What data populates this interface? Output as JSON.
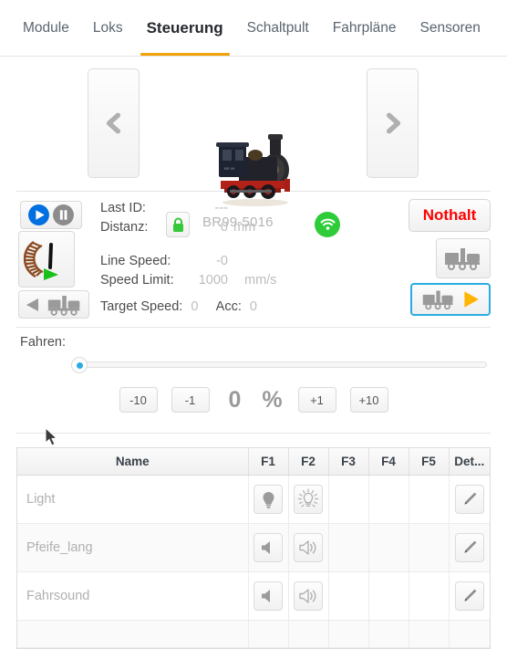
{
  "nav": {
    "tabs": [
      {
        "label": "Module",
        "active": false
      },
      {
        "label": "Loks",
        "active": false
      },
      {
        "label": "Steuerung",
        "active": true
      },
      {
        "label": "Schaltpult",
        "active": false
      },
      {
        "label": "Fahrpläne",
        "active": false
      },
      {
        "label": "Sensoren",
        "active": false
      }
    ],
    "accent_color": "#f0a30a"
  },
  "loco": {
    "prev_icon": "chevron-left-icon",
    "next_icon": "chevron-right-icon",
    "image_alt": "steam-locomotive",
    "lock_icon": "lock-closed-icon",
    "lock_color": "#35c93a",
    "name": "BR99-5016",
    "wifi_icon": "wifi-icon",
    "wifi_color": "#2fcc3a"
  },
  "controls": {
    "play_icon": "play-icon",
    "pause_icon": "pause-icon",
    "play_color": "#0070e0",
    "pause_color": "#8c8c8c",
    "speedometer_icon": "speedometer-icon",
    "reverse_loco_icon": "locomotive-reverse-icon",
    "readout": {
      "last_id_label": "Last ID:",
      "last_id_value": "---",
      "distanz_label": "Distanz:",
      "distanz_value": "0",
      "distanz_unit": "mm",
      "line_speed_label": "Line Speed:",
      "line_speed_value": "-0",
      "speed_limit_label": "Speed Limit:",
      "speed_limit_value": "1000",
      "speed_limit_unit": "mm/s",
      "target_speed_label": "Target Speed:",
      "target_speed_value": "0",
      "acc_label": "Acc:",
      "acc_value": "0"
    },
    "nothalt_label": "Nothalt",
    "nothalt_color": "#ff0000",
    "dir_reverse_icon": "locomotive-icon",
    "dir_forward_icon": "locomotive-forward-icon",
    "dir_forward_arrow_color": "#ffb400",
    "dir_forward_selected_color": "#2aabe2"
  },
  "drive": {
    "label": "Fahren:",
    "slider_value": 0,
    "slider_min": 0,
    "slider_max": 100,
    "handle_color": "#2aabe2",
    "minus_ten": "-10",
    "minus_one": "-1",
    "value": "0",
    "percent_symbol": "%",
    "plus_one": "+1",
    "plus_ten": "+10"
  },
  "functions": {
    "headers": [
      "Name",
      "F1",
      "F2",
      "F3",
      "F4",
      "F5",
      "Det..."
    ],
    "rows": [
      {
        "name": "Light",
        "f1_icon": "lightbulb-off-icon",
        "f2_icon": "lightbulb-on-icon",
        "f3_icon": "",
        "f4_icon": "",
        "f5_icon": "",
        "detail_icon": "pencil-icon"
      },
      {
        "name": "Pfeife_lang",
        "f1_icon": "speaker-mute-icon",
        "f2_icon": "speaker-on-icon",
        "f3_icon": "",
        "f4_icon": "",
        "f5_icon": "",
        "detail_icon": "pencil-icon"
      },
      {
        "name": "Fahrsound",
        "f1_icon": "speaker-mute-icon",
        "f2_icon": "speaker-on-icon",
        "f3_icon": "",
        "f4_icon": "",
        "f5_icon": "",
        "detail_icon": "pencil-icon"
      }
    ]
  }
}
